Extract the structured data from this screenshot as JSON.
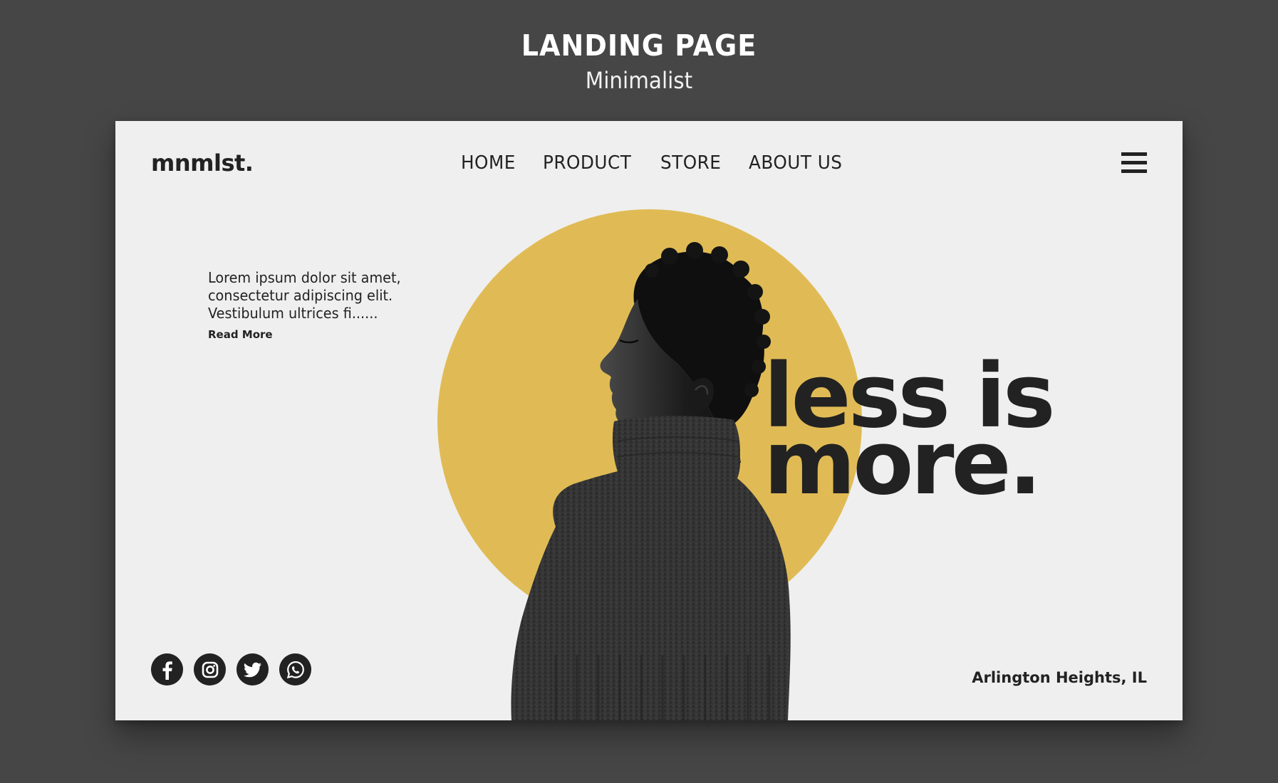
{
  "showcase": {
    "title": "LANDING PAGE",
    "subtitle": "Minimalist"
  },
  "site": {
    "brand": "mnmlst.",
    "nav": [
      "HOME",
      "PRODUCT",
      "STORE",
      "ABOUT US"
    ],
    "menu_icon": "hamburger-menu-icon",
    "intro": {
      "text": "Lorem ipsum dolor sit amet, consectetur adipiscing elit. Vestibulum ultrices fi......",
      "link": "Read More"
    },
    "tagline": {
      "line1": "less is",
      "line2": "more."
    },
    "socials": [
      "facebook-icon",
      "instagram-icon",
      "twitter-icon",
      "whatsapp-icon"
    ],
    "location": "Arlington Heights, IL"
  },
  "colors": {
    "background": "#464646",
    "page": "#efefef",
    "accent": "#e0bb55",
    "text": "#222222"
  }
}
